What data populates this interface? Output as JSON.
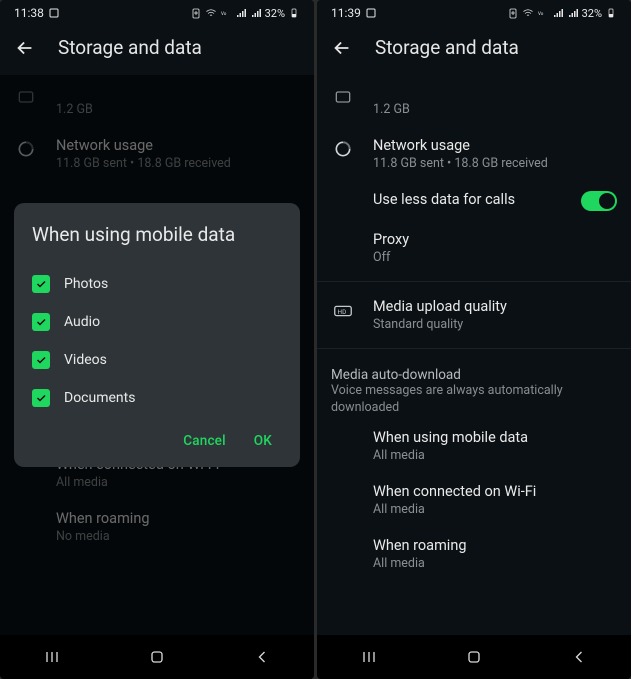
{
  "left": {
    "status": {
      "time": "11:38",
      "battery_pct": "32%"
    },
    "appbar_title": "Storage and data",
    "manage_storage_sub": "1.2 GB",
    "network_usage": {
      "title": "Network usage",
      "sub": "11.8 GB sent • 18.8 GB received"
    },
    "dialog": {
      "title": "When using mobile data",
      "options": {
        "photos": "Photos",
        "audio": "Audio",
        "videos": "Videos",
        "documents": "Documents"
      },
      "cancel": "Cancel",
      "ok": "OK"
    },
    "behind_rows": {
      "no_media": "No media",
      "wifi_title": "When connected on Wi-Fi",
      "wifi_sub": "All media",
      "roaming_title": "When roaming",
      "roaming_sub": "No media"
    }
  },
  "right": {
    "status": {
      "time": "11:39",
      "battery_pct": "32%"
    },
    "appbar_title": "Storage and data",
    "manage_storage_sub": "1.2 GB",
    "network_usage": {
      "title": "Network usage",
      "sub": "11.8 GB sent • 18.8 GB received"
    },
    "use_less_data": "Use less data for calls",
    "proxy": {
      "title": "Proxy",
      "sub": "Off"
    },
    "upload_quality": {
      "title": "Media upload quality",
      "sub": "Standard quality"
    },
    "auto_dl_header": {
      "title": "Media auto-download",
      "sub": "Voice messages are always automatically downloaded"
    },
    "mobile": {
      "title": "When using mobile data",
      "sub": "All media"
    },
    "wifi": {
      "title": "When connected on Wi-Fi",
      "sub": "All media"
    },
    "roaming": {
      "title": "When roaming",
      "sub": "All media"
    }
  }
}
